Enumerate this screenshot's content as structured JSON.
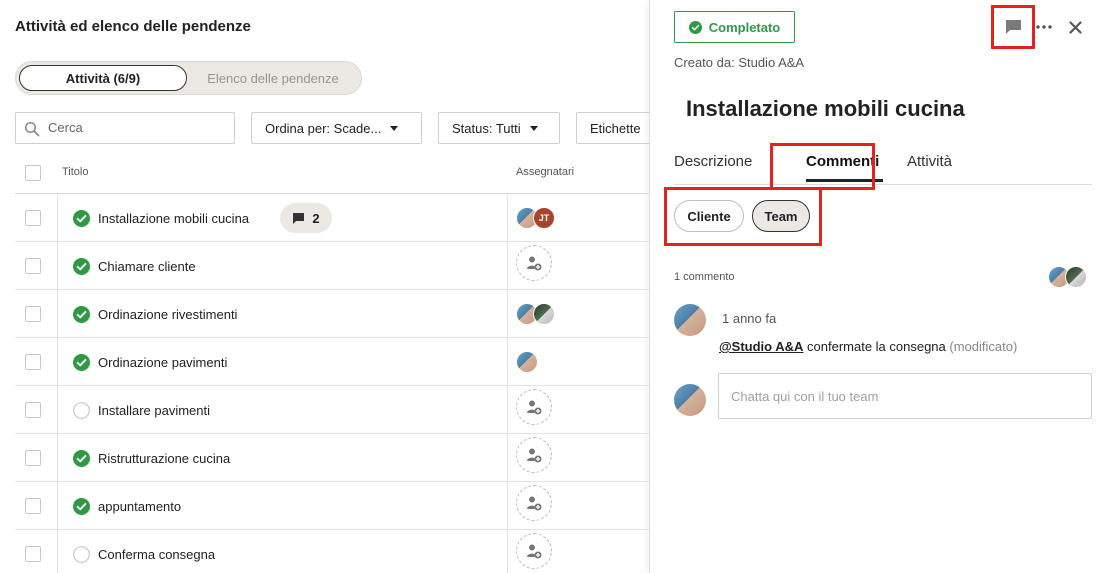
{
  "left": {
    "title": "Attività ed elenco delle pendenze",
    "tabs": [
      {
        "label": "Attività (6/9)",
        "active": true
      },
      {
        "label": "Elenco delle pendenze",
        "active": false
      }
    ],
    "search": {
      "placeholder": "Cerca",
      "value": ""
    },
    "filters": [
      {
        "label": "Ordina per: Scade..."
      },
      {
        "label": "Status: Tutti"
      },
      {
        "label": "Etichette"
      }
    ],
    "columns": {
      "title": "Titolo",
      "assignees": "Assegnatari"
    },
    "rows": [
      {
        "title": "Installazione mobili cucina",
        "done": true,
        "comments": "2",
        "assignees": "photo+JT"
      },
      {
        "title": "Chiamare cliente",
        "done": true,
        "assignees": "empty"
      },
      {
        "title": "Ordinazione rivestimenti",
        "done": true,
        "assignees": "photo+photo2"
      },
      {
        "title": "Ordinazione pavimenti",
        "done": true,
        "assignees": "photo"
      },
      {
        "title": "Installare pavimenti",
        "done": false,
        "assignees": "empty"
      },
      {
        "title": "Ristrutturazione cucina",
        "done": true,
        "assignees": "empty"
      },
      {
        "title": "appuntamento",
        "done": true,
        "assignees": "empty"
      },
      {
        "title": "Conferma consegna",
        "done": false,
        "assignees": "empty"
      }
    ],
    "avatar_initials": "JT"
  },
  "detail": {
    "status_label": "Completato",
    "created_by": "Creato da: Studio A&A",
    "title": "Installazione mobili cucina",
    "tabs": [
      {
        "label": "Descrizione",
        "active": false
      },
      {
        "label": "Commenti",
        "active": true
      },
      {
        "label": "Attività",
        "active": false
      }
    ],
    "audience": [
      {
        "label": "Cliente",
        "active": false
      },
      {
        "label": "Team",
        "active": true
      }
    ],
    "comment_count": "1 commento",
    "comment": {
      "time": "1 anno fa",
      "mention": "@Studio A&A",
      "text": " confermate la consegna ",
      "edited": "(modificato)"
    },
    "chat_placeholder": "Chatta qui con il tuo team"
  },
  "icons": {
    "comment": "comment-icon",
    "more": "more-icon",
    "close": "close-icon",
    "check": "check-circle-icon",
    "search": "search-icon",
    "add_user": "add-user-icon"
  },
  "colors": {
    "success": "#2e9a48",
    "highlight": "#e3231f",
    "pill_bg": "#ece9e5",
    "jt_avatar": "#a5442a"
  }
}
